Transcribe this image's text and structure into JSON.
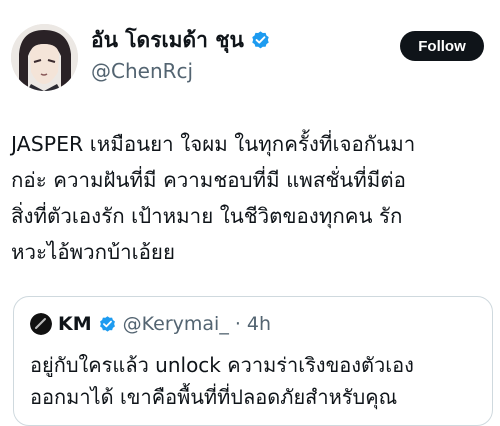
{
  "author": {
    "display_name": "อัน โดรเมด้า ชุน",
    "handle": "@ChenRcj",
    "avatar_icon": "anime-character-avatar",
    "verified_icon": "verified-badge-icon"
  },
  "follow_button": {
    "label": "Follow"
  },
  "tweet": {
    "lines": [
      "JASPER เหมือนยา ใจผม ในทุกครั้งที่เจอกันมา",
      "กอ่ะ ความฝันที่มี ความชอบที่มี แพสชั่นที่มีต่อ",
      "สิ่งที่ตัวเองรัก เป้าหมาย ในชีวิตของทุกคน รัก",
      "หวะไอ้พวกบ้าเอ้ยย"
    ]
  },
  "quoted_tweet": {
    "name": "KM",
    "handle": "@Kerymai_",
    "separator": "·",
    "time": "4h",
    "lines": [
      "อยู่กับใครแล้ว unlock ความร่าเริงของตัวเอง",
      "ออกมาได้ เขาคือพื้นที่ที่ปลอดภัยสำหรับคุณ"
    ]
  },
  "colors": {
    "verified_blue": "#1d9bf0",
    "text_primary": "#0f1419",
    "text_secondary": "#536471",
    "border": "#cfd9de",
    "button_bg": "#0f1419"
  }
}
